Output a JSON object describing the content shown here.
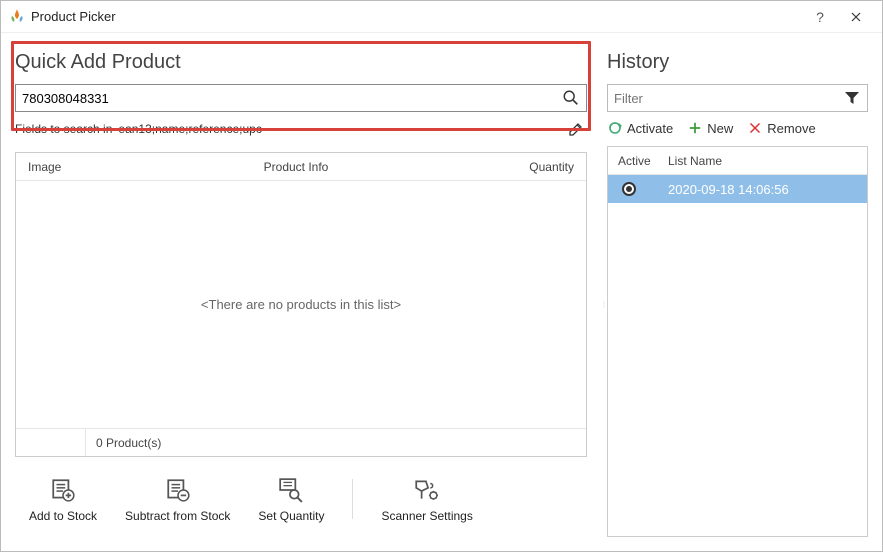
{
  "window": {
    "title": "Product Picker"
  },
  "left": {
    "heading": "Quick Add Product",
    "search_value": "780308048331",
    "fields_label": "Fields to search in",
    "fields_value": "ean13;name;reference;upc",
    "columns": {
      "image": "Image",
      "info": "Product Info",
      "qty": "Quantity"
    },
    "empty_msg": "<There are no products in this list>",
    "count_label": "0 Product(s)"
  },
  "toolbar": {
    "add": "Add to Stock",
    "sub": "Subtract from Stock",
    "set": "Set Quantity",
    "scan": "Scanner Settings"
  },
  "right": {
    "heading": "History",
    "filter_placeholder": "Filter",
    "activate": "Activate",
    "new": "New",
    "remove": "Remove",
    "col_active": "Active",
    "col_name": "List Name",
    "row_name": "2020-09-18 14:06:56"
  }
}
